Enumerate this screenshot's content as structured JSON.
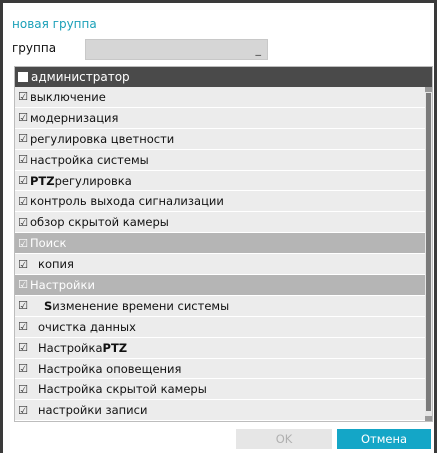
{
  "dialog": {
    "title": "новая группа",
    "group_label": "группа",
    "group_value": "",
    "cursor": "_"
  },
  "list": {
    "header": "администратор",
    "items": [
      {
        "label": "выключение",
        "checked": true
      },
      {
        "label": "модернизация",
        "checked": true
      },
      {
        "label": "регулировка цветности",
        "checked": true
      },
      {
        "label": "настройка системы",
        "checked": true
      },
      {
        "label_bold": "PTZ",
        "label": " регулировка",
        "checked": true
      },
      {
        "label": "контроль выхода сигнализации",
        "checked": true
      },
      {
        "label": "обзор скрытой камеры",
        "checked": true
      },
      {
        "label": "Поиск",
        "checked": true,
        "section": true
      },
      {
        "label": "копия",
        "checked": true,
        "child": true
      },
      {
        "label": "Настройки",
        "checked": true,
        "section": true
      },
      {
        "label_bold": "S",
        "label": "изменение времени системы",
        "checked": true,
        "child": true
      },
      {
        "label": "очистка данных",
        "checked": true,
        "child": true
      },
      {
        "label": "Настройка ",
        "label_bold": "PTZ",
        "checked": true,
        "child": true
      },
      {
        "label": "Настройка оповещения",
        "checked": true,
        "child": true
      },
      {
        "label": "Настройка скрытой камеры",
        "checked": true,
        "child": true
      },
      {
        "label": "настройки записи",
        "checked": true,
        "child": true
      }
    ]
  },
  "buttons": {
    "ok": "OK",
    "cancel": "Отмена"
  },
  "colors": {
    "accent": "#14a6c7",
    "title": "#1aa0b8",
    "header_bg": "#4a4a4a",
    "section_bg": "#b5b5b5",
    "row_bg": "#ececec"
  },
  "icons": {
    "check": "checkmark-icon",
    "unchecked": "empty-checkbox-icon"
  }
}
